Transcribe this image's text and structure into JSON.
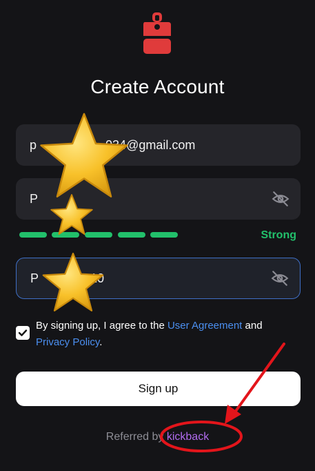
{
  "title": "Create Account",
  "email_field": {
    "value": "p                    034@gmail.com"
  },
  "password_field": {
    "value": "P"
  },
  "password_strength": {
    "label": "Strong",
    "segments_filled": 5,
    "segments_total": 5,
    "color": "#22c06b"
  },
  "confirm_field": {
    "value": "P               10"
  },
  "terms": {
    "checked": true,
    "prefix": "By signing up, I agree to the ",
    "user_agreement": "User Agreement",
    "middle": " and",
    "privacy_policy": "Privacy Policy",
    "suffix": "."
  },
  "signup_button": {
    "label": "Sign up"
  },
  "referral": {
    "prefix": "Referred by ",
    "name": "kickback"
  },
  "colors": {
    "accent": "#e03b3b",
    "link": "#4b8ff0",
    "referral": "#b26cf0",
    "annotation": "#e3151b"
  }
}
